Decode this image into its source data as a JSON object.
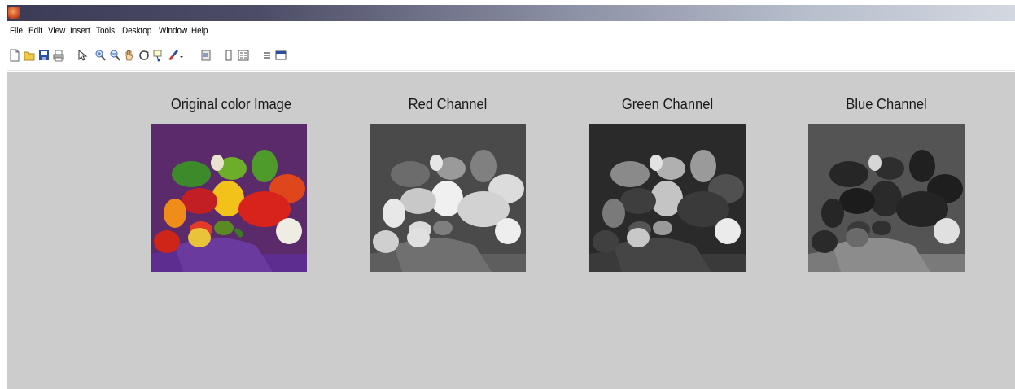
{
  "menubar": {
    "items": [
      "File",
      "Edit",
      "View",
      "Insert",
      "Tools",
      "Desktop",
      "Window",
      "Help"
    ]
  },
  "toolbar": {
    "icons": [
      "new-figure-icon",
      "open-file-icon",
      "save-icon",
      "print-icon",
      "select-arrow-icon",
      "zoom-in-icon",
      "zoom-out-icon",
      "pan-hand-icon",
      "rotate-3d-icon",
      "data-cursor-icon",
      "brush-icon",
      "link-icon",
      "colorbar-icon",
      "legend-icon",
      "hide-plot-tools-icon",
      "show-plot-tools-icon"
    ]
  },
  "figure": {
    "panels": [
      {
        "title": "Original color Image",
        "channel": "rgb"
      },
      {
        "title": "Red Channel",
        "channel": "red"
      },
      {
        "title": "Green Channel",
        "channel": "green"
      },
      {
        "title": "Blue Channel",
        "channel": "blue"
      }
    ],
    "background": "#cccccc"
  }
}
